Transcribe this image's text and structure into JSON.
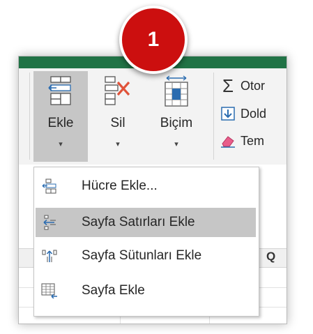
{
  "callout": {
    "number": "1"
  },
  "ribbon": {
    "insert": {
      "label": "Ekle",
      "arrow": "▾"
    },
    "delete": {
      "label": "Sil",
      "arrow": "▾"
    },
    "format": {
      "label": "Biçim",
      "arrow": "▾"
    },
    "editing": {
      "autosum": "Otor",
      "fill": "Dold",
      "clear": "Tem"
    }
  },
  "menu": {
    "items": [
      {
        "label": "Hücre Ekle...",
        "icon": "insert-cells-icon",
        "highlighted": false
      },
      {
        "label": "Sayfa Satırları Ekle",
        "icon": "insert-rows-icon",
        "highlighted": true
      },
      {
        "label": "Sayfa Sütunları Ekle",
        "icon": "insert-columns-icon",
        "highlighted": false
      },
      {
        "label": "Sayfa Ekle",
        "icon": "insert-sheet-icon",
        "highlighted": false
      }
    ]
  },
  "sheet": {
    "column_letter": "Q"
  },
  "colors": {
    "excel_green": "#217346",
    "callout_red": "#cc0f0f",
    "highlight": "#c6c6c6",
    "icon_blue": "#2b6cb0"
  }
}
